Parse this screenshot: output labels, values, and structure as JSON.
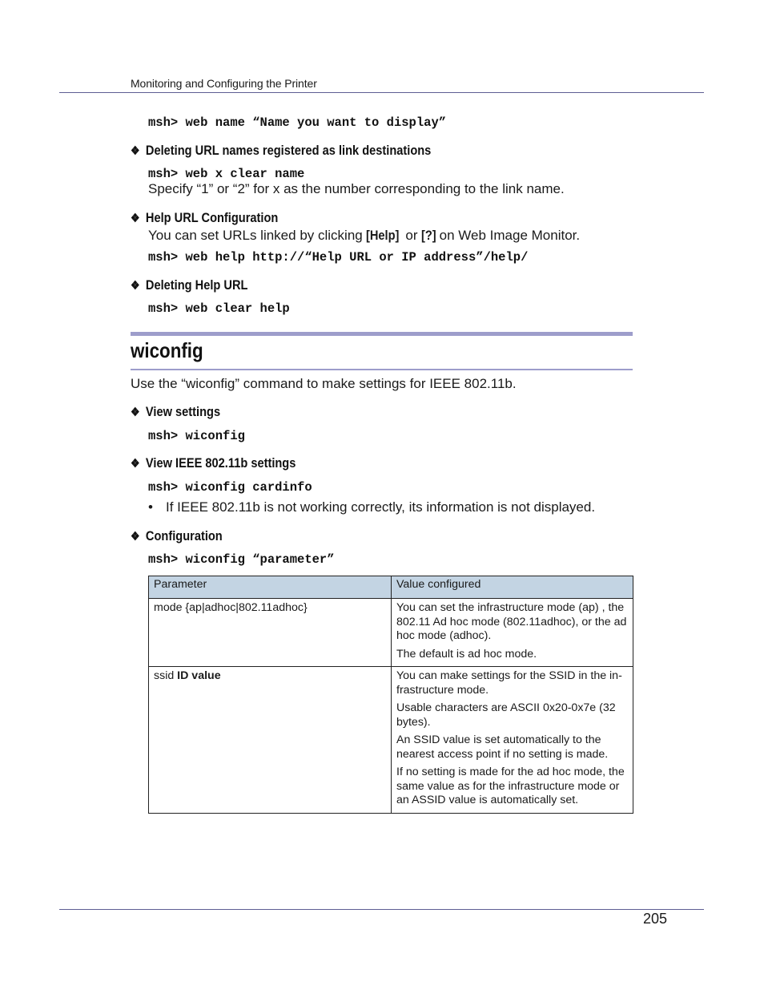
{
  "running_head": "Monitoring and Configuring the Printer",
  "page_number": "205",
  "blocks": {
    "cmd_web_name": "msh> web name “Name you want to display”",
    "del_url_names": {
      "heading": "Deleting URL names registered as link destinations",
      "command": "msh> web x clear name",
      "note": "Specify “1” or “2” for x as the number corresponding to the link name."
    },
    "help_url_config": {
      "heading": "Help URL Configuration",
      "text_before": "You can set URLs linked by clicking ",
      "help_key": "[Help]",
      "text_mid": " or ",
      "q_key": "[?]",
      "text_after": " on Web Image Monitor.",
      "command": "msh> web help http://“Help URL or IP address”/help/"
    },
    "del_help_url": {
      "heading": "Deleting Help URL",
      "command": "msh> web clear help"
    }
  },
  "section": {
    "title": "wiconfig",
    "intro": "Use the “wiconfig” command to make settings for IEEE 802.11b.",
    "view_settings": {
      "heading": "View settings",
      "command": "msh> wiconfig"
    },
    "view_ieee": {
      "heading": "View IEEE 802.11b settings",
      "command": "msh> wiconfig cardinfo",
      "bullet": "If IEEE 802.11b is not working correctly, its information is not displayed."
    },
    "configuration": {
      "heading": "Configuration",
      "command": "msh> wiconfig “parameter”"
    }
  },
  "icons": {
    "heading_bullet": "four-diamond-icon",
    "list_bullet": "bullet-dot"
  },
  "table": {
    "headers": [
      "Parameter",
      "Value configured"
    ],
    "rows": [
      {
        "param_plain": "mode {ap|adhoc|802.11adhoc}",
        "param_bold": "",
        "values": [
          "You can set the infrastructure mode (ap) , the 802.11 Ad hoc mode (802.11adhoc), or the ad hoc mode (adhoc).",
          "The default is ad hoc mode."
        ]
      },
      {
        "param_plain": "ssid ",
        "param_bold": "ID value",
        "values": [
          "You can make settings for the SSID in the in-frastructure mode.",
          "Usable characters are ASCII 0x20-0x7e (32 bytes).",
          "An SSID value is set automatically to the nearest access point if no setting is made.",
          "If no setting is made for the ad hoc mode, the same value as for the infrastructure mode or an ASSID value is automatically set."
        ]
      }
    ]
  },
  "colors": {
    "rule": "#5e5e93",
    "section_bar": "#9d9dcb",
    "table_header_bg": "#c3d4e3"
  }
}
